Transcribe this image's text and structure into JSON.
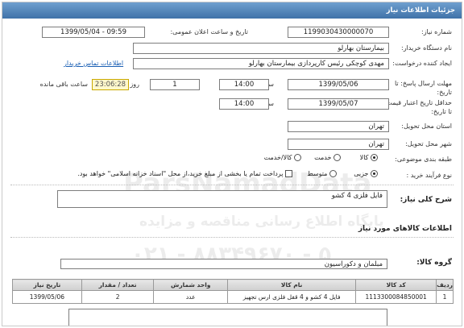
{
  "header": {
    "title": "جزئیات اطلاعات نیاز"
  },
  "fields": {
    "need_number_label": "شماره نیاز:",
    "need_number": "1199030430000070",
    "announce_label": "تاریخ و ساعت اعلان عمومی:",
    "announce_value": "1399/05/04 - 09:59",
    "buyer_label": "نام دستگاه خریدار:",
    "buyer": "بیمارستان بهارلو",
    "creator_label": "ایجاد کننده درخواست:",
    "creator": "مهدی کوچکی  رئیس کارپردازی بیمارستان بهارلو",
    "contact_link": "اطلاعات تماس خریدار",
    "deadline_label": "مهلت ارسال پاسخ: تا تاریخ:",
    "deadline_date": "1399/05/06",
    "time_label": "ساعت",
    "deadline_time": "14:00",
    "days": "1",
    "days_label": "روز و",
    "remaining": "23:06:28",
    "remaining_label": "ساعت باقی مانده",
    "validity_label": "حداقل تاریخ اعتبار قیمت: تا تاریخ:",
    "validity_date": "1399/05/07",
    "validity_time_label": "ساعت",
    "validity_time": "14:00",
    "province_label": "استان محل تحویل:",
    "province": "تهران",
    "city_label": "شهر محل تحویل:",
    "city": "تهران",
    "category_label": "طبقه بندی موضوعی:",
    "category_options": [
      "کالا",
      "خدمت",
      "کالا/خدمت"
    ],
    "process_label": "نوع فرآیند خرید :",
    "process_options": [
      "جزیی",
      "متوسط"
    ],
    "payment_note": "پرداخت تمام یا بخشی از مبلغ خرید،از محل \"اسناد خزانه اسلامی\" خواهد بود."
  },
  "summary": {
    "label": "شرح کلی نیاز:",
    "value": "فایل فلزی 4 کشو"
  },
  "goods": {
    "title": "اطلاعات کالاهای مورد نیاز",
    "group_label": "گروه کالا:",
    "group_value": "مبلمان و دکوراسیون",
    "columns": [
      "ردیف",
      "کد کالا",
      "نام کالا",
      "واحد شمارش",
      "تعداد / مقدار",
      "تاریخ نیاز"
    ],
    "rows": [
      [
        "1",
        "1113300084850001",
        "فایل 4 کشو و 4 قفل فلزی ارس تجهیز",
        "عدد",
        "2",
        "1399/05/06"
      ]
    ]
  },
  "watermark": {
    "brand": "ParsNamadData",
    "line1": "پایگاه اطلاع رسانی مناقصه و مزایده",
    "phone": "۰۲۱ - ۸۸۳۴۹۶۷۰ - ۵"
  }
}
